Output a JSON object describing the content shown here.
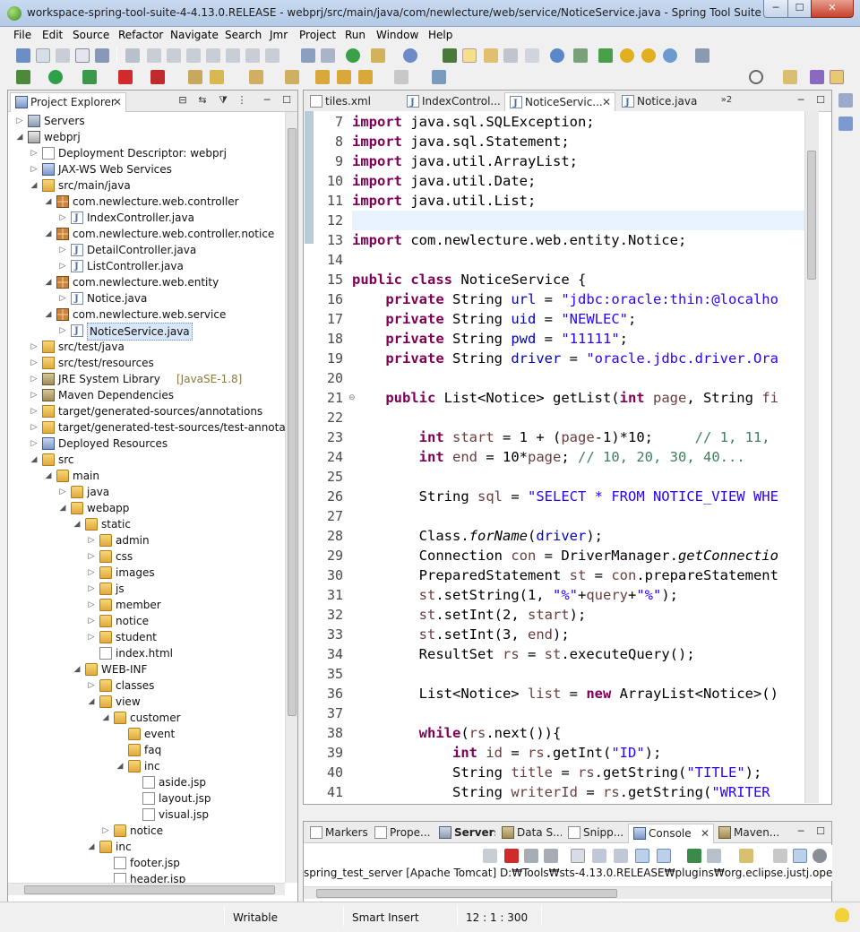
{
  "window": {
    "title": "workspace-spring-tool-suite-4-4.13.0.RELEASE - webprj/src/main/java/com/newlecture/web/service/NoticeService.java - Spring Tool Suite 4",
    "min_label": "─",
    "max_label": "☐",
    "close_label": "✕"
  },
  "menu": [
    "File",
    "Edit",
    "Source",
    "Refactor",
    "Navigate",
    "Search",
    "Jmr",
    "Project",
    "Run",
    "Window",
    "Help"
  ],
  "project_explorer": {
    "title": "Project Explorer",
    "close": "✕",
    "items": [
      {
        "label": "Servers",
        "deco": ""
      },
      {
        "label": "webprj",
        "deco": ""
      },
      {
        "label": "Deployment Descriptor: webprj",
        "deco": ""
      },
      {
        "label": "JAX-WS Web Services",
        "deco": ""
      },
      {
        "label": "src/main/java",
        "deco": ""
      },
      {
        "label": "com.newlecture.web.controller",
        "deco": ""
      },
      {
        "label": "IndexController.java",
        "deco": ""
      },
      {
        "label": "com.newlecture.web.controller.notice",
        "deco": ""
      },
      {
        "label": "DetailController.java",
        "deco": ""
      },
      {
        "label": "ListController.java",
        "deco": ""
      },
      {
        "label": "com.newlecture.web.entity",
        "deco": ""
      },
      {
        "label": "Notice.java",
        "deco": ""
      },
      {
        "label": "com.newlecture.web.service",
        "deco": ""
      },
      {
        "label": "NoticeService.java",
        "deco": ""
      },
      {
        "label": "src/test/java",
        "deco": ""
      },
      {
        "label": "src/test/resources",
        "deco": ""
      },
      {
        "label": "JRE System Library",
        "deco": "[JavaSE-1.8]"
      },
      {
        "label": "Maven Dependencies",
        "deco": ""
      },
      {
        "label": "target/generated-sources/annotations",
        "deco": ""
      },
      {
        "label": "target/generated-test-sources/test-annotations",
        "deco": ""
      },
      {
        "label": "Deployed Resources",
        "deco": ""
      },
      {
        "label": "src",
        "deco": ""
      },
      {
        "label": "main",
        "deco": ""
      },
      {
        "label": "java",
        "deco": ""
      },
      {
        "label": "webapp",
        "deco": ""
      },
      {
        "label": "static",
        "deco": ""
      },
      {
        "label": "admin",
        "deco": ""
      },
      {
        "label": "css",
        "deco": ""
      },
      {
        "label": "images",
        "deco": ""
      },
      {
        "label": "js",
        "deco": ""
      },
      {
        "label": "member",
        "deco": ""
      },
      {
        "label": "notice",
        "deco": ""
      },
      {
        "label": "student",
        "deco": ""
      },
      {
        "label": "index.html",
        "deco": ""
      },
      {
        "label": "WEB-INF",
        "deco": ""
      },
      {
        "label": "classes",
        "deco": ""
      },
      {
        "label": "view",
        "deco": ""
      },
      {
        "label": "customer",
        "deco": ""
      },
      {
        "label": "event",
        "deco": ""
      },
      {
        "label": "faq",
        "deco": ""
      },
      {
        "label": "inc",
        "deco": ""
      },
      {
        "label": "aside.jsp",
        "deco": ""
      },
      {
        "label": "layout.jsp",
        "deco": ""
      },
      {
        "label": "visual.jsp",
        "deco": ""
      },
      {
        "label": "notice",
        "deco": ""
      },
      {
        "label": "inc",
        "deco": ""
      },
      {
        "label": "footer.jsp",
        "deco": ""
      },
      {
        "label": "header.jsp",
        "deco": ""
      }
    ]
  },
  "editor": {
    "tabs": [
      "tiles.xml",
      "IndexControl...",
      "NoticeServic...",
      "Notice.java"
    ],
    "overflow": "»2",
    "active_close": "✕",
    "lines": [
      {
        "n": "7",
        "segs": [
          [
            "kw",
            "import"
          ],
          [
            "",
            "java.sql.SQLException;"
          ]
        ]
      },
      {
        "n": "8",
        "segs": [
          [
            "kw",
            "import"
          ],
          [
            "",
            "java.sql.Statement;"
          ]
        ]
      },
      {
        "n": "9",
        "segs": [
          [
            "kw",
            "import"
          ],
          [
            "",
            "java.util.ArrayList;"
          ]
        ]
      },
      {
        "n": "10",
        "segs": [
          [
            "kw",
            "import"
          ],
          [
            "",
            "java.util.Date;"
          ]
        ]
      },
      {
        "n": "11",
        "segs": [
          [
            "kw",
            "import"
          ],
          [
            "",
            "java.util.List;"
          ]
        ]
      },
      {
        "n": "12",
        "segs": []
      },
      {
        "n": "13",
        "segs": [
          [
            "kw",
            "import"
          ],
          [
            "",
            "com.newlecture.web.entity.Notice;"
          ]
        ]
      },
      {
        "n": "14",
        "segs": []
      },
      {
        "n": "15",
        "segs": [
          [
            "kw",
            "public"
          ],
          [
            "",
            ""
          ],
          [
            "kw",
            "class"
          ],
          [
            "",
            "NoticeService {"
          ]
        ]
      },
      {
        "n": "16",
        "segs": [
          [
            "",
            "    "
          ],
          [
            "kw",
            "private"
          ],
          [
            "",
            "String "
          ],
          [
            "fld",
            "url"
          ],
          [
            "",
            "= "
          ],
          [
            "str",
            "\"jdbc:oracle:thin:@localho"
          ]
        ]
      },
      {
        "n": "17",
        "segs": [
          [
            "",
            "    "
          ],
          [
            "kw",
            "private"
          ],
          [
            "",
            "String "
          ],
          [
            "fld",
            "uid"
          ],
          [
            "",
            "= "
          ],
          [
            "str",
            "\"NEWLEC\""
          ],
          [
            "",
            ";"
          ]
        ]
      },
      {
        "n": "18",
        "segs": [
          [
            "",
            "    "
          ],
          [
            "kw",
            "private"
          ],
          [
            "",
            "String "
          ],
          [
            "fld",
            "pwd"
          ],
          [
            "",
            "= "
          ],
          [
            "str",
            "\"11111\""
          ],
          [
            "",
            ";"
          ]
        ]
      },
      {
        "n": "19",
        "segs": [
          [
            "",
            "    "
          ],
          [
            "kw",
            "private"
          ],
          [
            "",
            "String "
          ],
          [
            "fld",
            "driver"
          ],
          [
            "",
            "= "
          ],
          [
            "str",
            "\"oracle.jdbc.driver.Ora"
          ]
        ]
      },
      {
        "n": "20",
        "segs": []
      },
      {
        "n": "21",
        "segs": [
          [
            "",
            "    "
          ],
          [
            "kw",
            "public"
          ],
          [
            "",
            "List<Notice> getList("
          ],
          [
            "kw",
            "int"
          ],
          [
            "",
            ""
          ],
          [
            "var",
            "page"
          ],
          [
            "",
            ", String "
          ],
          [
            "var",
            "fi"
          ]
        ]
      },
      {
        "n": "22",
        "segs": []
      },
      {
        "n": "23",
        "segs": [
          [
            "",
            "        "
          ],
          [
            "kw",
            "int"
          ],
          [
            "",
            ""
          ],
          [
            "var",
            "start"
          ],
          [
            "",
            "= 1 + ("
          ],
          [
            "var",
            "page"
          ],
          [
            "",
            "-1)*10;     "
          ],
          [
            "cmt",
            "// 1, 11,"
          ]
        ]
      },
      {
        "n": "24",
        "segs": [
          [
            "",
            "        "
          ],
          [
            "kw",
            "int"
          ],
          [
            "",
            ""
          ],
          [
            "var",
            "end"
          ],
          [
            "",
            "= 10*"
          ],
          [
            "var",
            "page"
          ],
          [
            "",
            "; "
          ],
          [
            "cmt",
            "// 10, 20, 30, 40..."
          ]
        ]
      },
      {
        "n": "25",
        "segs": []
      },
      {
        "n": "26",
        "segs": [
          [
            "",
            "        String "
          ],
          [
            "var",
            "sql"
          ],
          [
            "",
            "= "
          ],
          [
            "str",
            "\"SELECT * FROM NOTICE_VIEW WHE"
          ]
        ]
      },
      {
        "n": "27",
        "segs": []
      },
      {
        "n": "28",
        "segs": [
          [
            "",
            "        Class."
          ],
          [
            "sm",
            "forName"
          ],
          [
            "",
            "("
          ],
          [
            "fld",
            "driver"
          ],
          [
            "",
            ");"
          ]
        ]
      },
      {
        "n": "29",
        "segs": [
          [
            "",
            "        Connection "
          ],
          [
            "var",
            "con"
          ],
          [
            "",
            "= DriverManager."
          ],
          [
            "sm",
            "getConnectio"
          ]
        ]
      },
      {
        "n": "30",
        "segs": [
          [
            "",
            "        PreparedStatement "
          ],
          [
            "var",
            "st"
          ],
          [
            "",
            "= "
          ],
          [
            "var",
            "con"
          ],
          [
            "",
            ".prepareStatement"
          ]
        ]
      },
      {
        "n": "31",
        "segs": [
          [
            "",
            "        "
          ],
          [
            "var",
            "st"
          ],
          [
            "",
            ".setString(1, "
          ],
          [
            "str",
            "\"%\""
          ],
          [
            "",
            "+"
          ],
          [
            "var",
            "query"
          ],
          [
            "",
            "+"
          ],
          [
            "str",
            "\"%\""
          ],
          [
            "",
            ");"
          ]
        ]
      },
      {
        "n": "32",
        "segs": [
          [
            "",
            "        "
          ],
          [
            "var",
            "st"
          ],
          [
            "",
            ".setInt(2, "
          ],
          [
            "var",
            "start"
          ],
          [
            "",
            ");"
          ]
        ]
      },
      {
        "n": "33",
        "segs": [
          [
            "",
            "        "
          ],
          [
            "var",
            "st"
          ],
          [
            "",
            ".setInt(3, "
          ],
          [
            "var",
            "end"
          ],
          [
            "",
            ");"
          ]
        ]
      },
      {
        "n": "34",
        "segs": [
          [
            "",
            "        ResultSet "
          ],
          [
            "var",
            "rs"
          ],
          [
            "",
            "= "
          ],
          [
            "var",
            "st"
          ],
          [
            "",
            ".executeQuery();"
          ]
        ]
      },
      {
        "n": "35",
        "segs": []
      },
      {
        "n": "36",
        "segs": [
          [
            "",
            "        List<Notice> "
          ],
          [
            "var",
            "list"
          ],
          [
            "",
            "= "
          ],
          [
            "kw",
            "new"
          ],
          [
            "",
            "ArrayList<Notice>()"
          ]
        ]
      },
      {
        "n": "37",
        "segs": []
      },
      {
        "n": "38",
        "segs": [
          [
            "",
            "        "
          ],
          [
            "kw",
            "while"
          ],
          [
            "",
            "("
          ],
          [
            "var",
            "rs"
          ],
          [
            "",
            ".next()){"
          ]
        ]
      },
      {
        "n": "39",
        "segs": [
          [
            "",
            "            "
          ],
          [
            "kw",
            "int"
          ],
          [
            "",
            ""
          ],
          [
            "var",
            "id"
          ],
          [
            "",
            "= "
          ],
          [
            "var",
            "rs"
          ],
          [
            "",
            ".getInt("
          ],
          [
            "str",
            "\"ID\""
          ],
          [
            "",
            ");"
          ]
        ]
      },
      {
        "n": "40",
        "segs": [
          [
            "",
            "            String "
          ],
          [
            "var",
            "title"
          ],
          [
            "",
            "= "
          ],
          [
            "var",
            "rs"
          ],
          [
            "",
            ".getString("
          ],
          [
            "str",
            "\"TITLE\""
          ],
          [
            "",
            ");"
          ]
        ]
      },
      {
        "n": "41",
        "segs": [
          [
            "",
            "            String "
          ],
          [
            "var",
            "writerId"
          ],
          [
            "",
            "= "
          ],
          [
            "var",
            "rs"
          ],
          [
            "",
            ".getString("
          ],
          [
            "str",
            "\"WRITER"
          ]
        ]
      }
    ]
  },
  "bottom": {
    "tabs": [
      "Markers",
      "Prope...",
      "Servers",
      "Data S...",
      "Snipp...",
      "Console",
      "Maven..."
    ],
    "active_close": "✕",
    "console_text": "spring_test_server [Apache Tomcat] D:₩Tools₩sts-4.13.0.RELEASE₩plugins₩org.eclipse.justj.openjdk.hotspot.j"
  },
  "status": {
    "writable": "Writable",
    "insert_mode": "Smart Insert",
    "position": "12 : 1 : 300"
  }
}
